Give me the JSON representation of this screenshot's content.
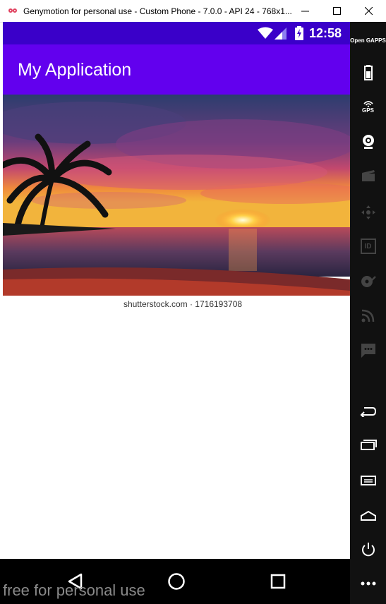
{
  "window": {
    "title": "Genymotion for personal use - Custom Phone - 7.0.0 - API 24 - 768x1...",
    "minimize_glyph": "—",
    "maximize_glyph": "☐",
    "close_glyph": "✕"
  },
  "statusbar": {
    "time": "12:58",
    "background": "#3a00c9"
  },
  "appbar": {
    "title": "My Application",
    "background": "#6200ee"
  },
  "photo": {
    "caption": "shutterstock.com · 1716193708"
  },
  "footer": {
    "watermark": "free for personal use"
  },
  "sidebar": {
    "open_gapps": "Open GAPPS",
    "gps": "GPS",
    "id_label": "ID",
    "items": [
      "battery-icon",
      "gps-icon",
      "webcam-icon",
      "clapperboard-icon",
      "dpad-icon",
      "id-icon",
      "disk-icon",
      "broadcast-icon",
      "sms-icon",
      "back-icon",
      "recent-apps-icon",
      "menu-icon",
      "home-icon",
      "power-icon",
      "more-icon"
    ]
  },
  "navbar": {
    "items": [
      "back-icon",
      "home-icon",
      "recent-apps-icon"
    ]
  }
}
